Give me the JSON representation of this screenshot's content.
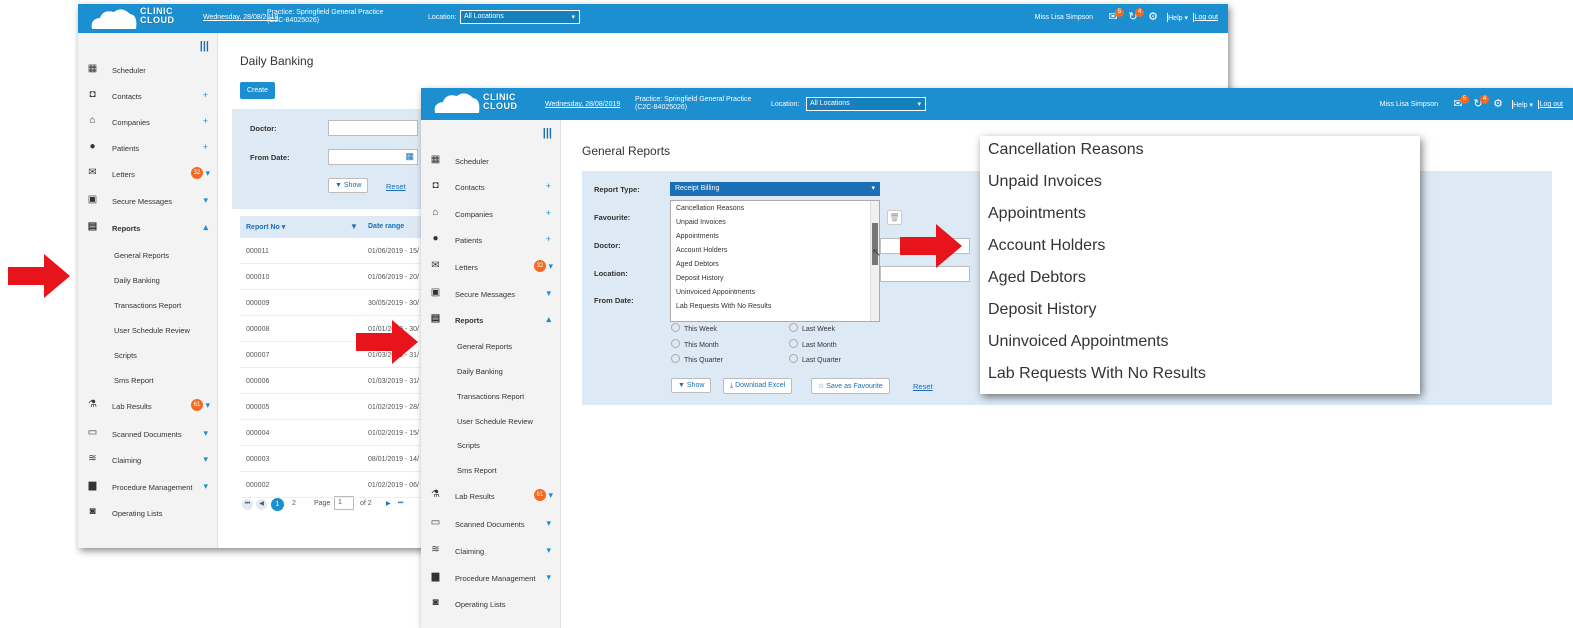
{
  "app": {
    "logo_text": [
      "CLINIC",
      "CLOUD"
    ],
    "date": "Wednesday, 28/08/2019",
    "practice": "Practice: Springfield General Practice (C2C-84025026)",
    "location_label": "Location:",
    "location_value": "All Locations",
    "user": "Miss Lisa Simpson",
    "messages_badge": "5",
    "alerts_badge": "4",
    "help": "Help",
    "logout": "Log out"
  },
  "sidebar": {
    "items": [
      {
        "label": "Scheduler",
        "icon": "calendar-icon"
      },
      {
        "label": "Contacts",
        "icon": "contact-card-icon",
        "trail": "+"
      },
      {
        "label": "Companies",
        "icon": "building-icon",
        "trail": "+"
      },
      {
        "label": "Patients",
        "icon": "person-icon",
        "trail": "+"
      },
      {
        "label": "Letters",
        "icon": "envelope-icon",
        "badge": "32",
        "trail": "▾"
      },
      {
        "label": "Secure Messages",
        "icon": "secure-mail-icon",
        "trail": "▾"
      },
      {
        "label": "Reports",
        "icon": "reports-icon",
        "trail": "▴"
      }
    ],
    "sub": [
      "General Reports",
      "Daily Banking",
      "Transactions Report",
      "User Schedule Review",
      "Scripts",
      "Sms Report"
    ],
    "items2": [
      {
        "label": "Lab Results",
        "icon": "lab-icon",
        "badge": "61",
        "trail": "▾"
      },
      {
        "label": "Scanned Documents",
        "icon": "document-icon",
        "trail": "▾"
      },
      {
        "label": "Claiming",
        "icon": "coins-icon",
        "trail": "▾"
      },
      {
        "label": "Procedure Management",
        "icon": "procedure-icon",
        "trail": "▾"
      },
      {
        "label": "Operating Lists",
        "icon": "operating-icon"
      }
    ]
  },
  "daily": {
    "title": "Daily Banking",
    "create": "Create",
    "doctor": "Doctor:",
    "from_date": "From Date:",
    "show": "Show",
    "reset": "Reset",
    "col1": "Report No",
    "col2": "Date range",
    "rows": [
      [
        "000011",
        "01/06/2019 - 15/"
      ],
      [
        "000010",
        "01/06/2019 - 20/"
      ],
      [
        "000009",
        "30/05/2019 - 30/"
      ],
      [
        "000008",
        "01/01/2019 - 30/"
      ],
      [
        "000007",
        "01/03/2019 - 31/"
      ],
      [
        "000006",
        "01/03/2019 - 31/"
      ],
      [
        "000005",
        "01/02/2019 - 28/"
      ],
      [
        "000004",
        "01/02/2019 - 15/"
      ],
      [
        "000003",
        "08/01/2019 - 14/"
      ],
      [
        "000002",
        "01/02/2019 - 06/"
      ]
    ],
    "pager": {
      "p1": "1",
      "p2": "2",
      "page_label": "Page",
      "page_value": "1",
      "of": "of 2"
    }
  },
  "general": {
    "title": "General Reports",
    "report_type": "Report Type:",
    "report_value": "Receipt Billing",
    "favourite": "Favourite:",
    "doctor": "Doctor:",
    "location": "Location:",
    "from_date": "From Date:",
    "options": [
      "Cancellation Reasons",
      "Unpaid Invoices",
      "Appointments",
      "Account Holders",
      "Aged Debtors",
      "Deposit History",
      "Uninvoiced Appointments",
      "Lab Requests With No Results"
    ],
    "radios": [
      "This Week",
      "Last Week",
      "This Month",
      "Last Month",
      "This Quarter",
      "Last Quarter"
    ],
    "show": "Show",
    "download": "Download Excel",
    "save_fav": "Save as Favourite",
    "reset": "Reset"
  },
  "zoom": {
    "items": [
      "Cancellation Reasons",
      "Unpaid Invoices",
      "Appointments",
      "Account Holders",
      "Aged Debtors",
      "Deposit History",
      "Uninvoiced Appointments",
      "Lab Requests With No Results"
    ]
  },
  "colors": {
    "header": "#1b8fcf",
    "arrow": "#e8141b",
    "badge": "#f26b21"
  }
}
